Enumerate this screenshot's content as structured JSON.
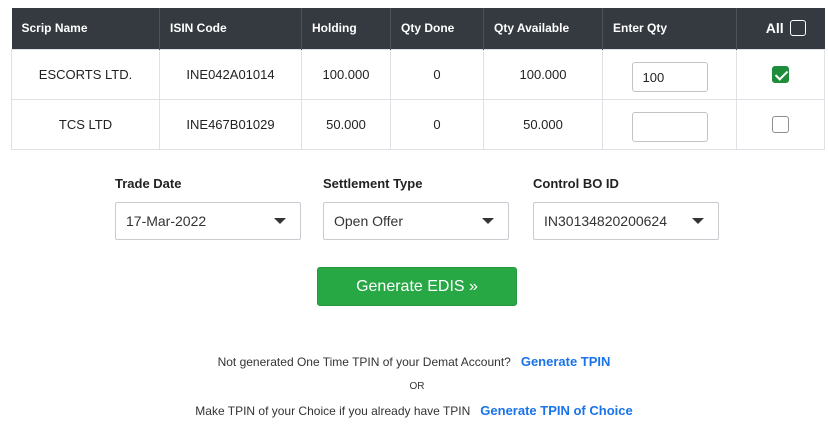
{
  "table": {
    "headers": [
      "Scrip Name",
      "ISIN Code",
      "Holding",
      "Qty Done",
      "Qty Available",
      "Enter Qty"
    ],
    "all_label": "All",
    "all_checked": false,
    "rows": [
      {
        "scrip": "ESCORTS LTD.",
        "isin": "INE042A01014",
        "holding": "100.000",
        "qty_done": "0",
        "qty_available": "100.000",
        "enter_qty": "100",
        "checked": true
      },
      {
        "scrip": "TCS LTD",
        "isin": "INE467B01029",
        "holding": "50.000",
        "qty_done": "0",
        "qty_available": "50.000",
        "enter_qty": "",
        "checked": false
      }
    ]
  },
  "form": {
    "trade_date": {
      "label": "Trade Date",
      "value": "17-Mar-2022"
    },
    "settlement_type": {
      "label": "Settlement Type",
      "value": "Open Offer"
    },
    "control_bo_id": {
      "label": "Control BO ID",
      "value": "IN30134820200624"
    }
  },
  "generate_button": "Generate EDIS »",
  "tpin": {
    "question": "Not generated One Time TPIN of your Demat Account?",
    "generate_link": "Generate TPIN",
    "or": "OR",
    "choice_text": "Make TPIN of your Choice if you already have TPIN",
    "choice_link": "Generate TPIN of Choice"
  },
  "colors": {
    "header_bg": "#343a40",
    "button_green": "#28a745",
    "checkbox_green": "#1e8c3a",
    "link_blue": "#1a73e8"
  }
}
